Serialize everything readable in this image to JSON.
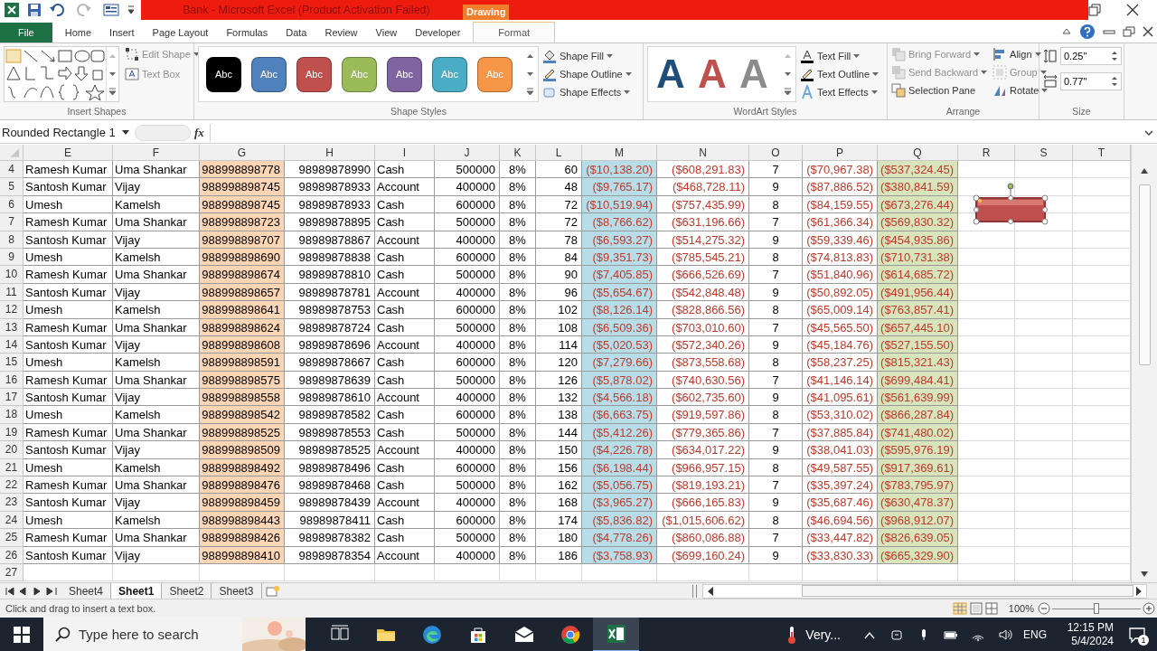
{
  "title_bar": {
    "title": "Bank - Microsoft Excel (Product Activation Failed)",
    "context_label": "Drawing"
  },
  "tabs": [
    {
      "label": "File",
      "kind": "file",
      "selected": false
    },
    {
      "label": "Home",
      "kind": "tab",
      "selected": false
    },
    {
      "label": "Insert",
      "kind": "tab",
      "selected": false
    },
    {
      "label": "Page Layout",
      "kind": "tab",
      "selected": false
    },
    {
      "label": "Formulas",
      "kind": "tab",
      "selected": false
    },
    {
      "label": "Data",
      "kind": "tab",
      "selected": false
    },
    {
      "label": "Review",
      "kind": "tab",
      "selected": false
    },
    {
      "label": "View",
      "kind": "tab",
      "selected": false
    },
    {
      "label": "Developer",
      "kind": "tab",
      "selected": false
    },
    {
      "label": "Format",
      "kind": "contextual",
      "selected": true
    }
  ],
  "ribbon": {
    "insert_shapes": {
      "label": "Insert Shapes",
      "edit_shape": "Edit Shape",
      "text_box": "Text Box"
    },
    "shape_styles": {
      "label": "Shape Styles",
      "swatches": [
        {
          "text": "Abc",
          "color": "#000000"
        },
        {
          "text": "Abc",
          "color": "#4f81bd"
        },
        {
          "text": "Abc",
          "color": "#c0504d"
        },
        {
          "text": "Abc",
          "color": "#9bbb59"
        },
        {
          "text": "Abc",
          "color": "#8064a2"
        },
        {
          "text": "Abc",
          "color": "#4bacc6"
        },
        {
          "text": "Abc",
          "color": "#f79646"
        }
      ],
      "commands": [
        "Shape Fill",
        "Shape Outline",
        "Shape Effects"
      ]
    },
    "wordart_styles": {
      "label": "WordArt Styles",
      "letters": [
        {
          "text": "A",
          "color": "#1f4e79"
        },
        {
          "text": "A",
          "color": "#c0504d"
        },
        {
          "text": "A",
          "color": "#8c8c8c"
        }
      ],
      "commands": [
        "Text Fill",
        "Text Outline",
        "Text Effects"
      ]
    },
    "arrange": {
      "label": "Arrange",
      "commands": [
        {
          "label": "Bring Forward",
          "disabled": true
        },
        {
          "label": "Send Backward",
          "disabled": true
        },
        {
          "label": "Selection Pane",
          "disabled": false
        },
        {
          "label": "Align",
          "disabled": false
        },
        {
          "label": "Group",
          "disabled": true
        },
        {
          "label": "Rotate",
          "disabled": false
        }
      ]
    },
    "size": {
      "label": "Size",
      "height": "0.25\"",
      "width": "0.77\""
    }
  },
  "formula_bar": {
    "name_box": "Rounded Rectangle 1",
    "fx": "fx"
  },
  "sheet": {
    "columns": [
      {
        "label": "E",
        "kind": "text"
      },
      {
        "label": "F",
        "kind": "text"
      },
      {
        "label": "G",
        "kind": "number",
        "color": "#fcd5b4"
      },
      {
        "label": "H",
        "kind": "number"
      },
      {
        "label": "I",
        "kind": "text"
      },
      {
        "label": "J",
        "kind": "number"
      },
      {
        "label": "K",
        "kind": "center"
      },
      {
        "label": "L",
        "kind": "number"
      },
      {
        "label": "M",
        "kind": "negative",
        "color": "#b7dee8"
      },
      {
        "label": "N",
        "kind": "negative"
      },
      {
        "label": "O",
        "kind": "center"
      },
      {
        "label": "P",
        "kind": "negative"
      },
      {
        "label": "Q",
        "kind": "negative",
        "color": "#d8e4bc"
      },
      {
        "label": "R",
        "kind": "text"
      },
      {
        "label": "S",
        "kind": "text"
      },
      {
        "label": "T",
        "kind": "text"
      }
    ],
    "rows": [
      {
        "header": "4",
        "cells": [
          "Ramesh Kumar",
          "Uma Shankar",
          "988998898778",
          "98989878990",
          "Cash",
          "500000",
          "8%",
          "60",
          "($10,138.20)",
          "($608,291.83)",
          "7",
          "($70,967.38)",
          "($537,324.45)"
        ]
      },
      {
        "header": "5",
        "cells": [
          "Santosh Kumar",
          "Vijay",
          "988998898745",
          "98989878933",
          "Account",
          "400000",
          "8%",
          "48",
          "($9,765.17)",
          "($468,728.11)",
          "9",
          "($87,886.52)",
          "($380,841.59)"
        ]
      },
      {
        "header": "6",
        "cells": [
          "Umesh",
          "Kamelsh",
          "988998898745",
          "98989878933",
          "Cash",
          "600000",
          "8%",
          "72",
          "($10,519.94)",
          "($757,435.99)",
          "8",
          "($84,159.55)",
          "($673,276.44)"
        ]
      },
      {
        "header": "7",
        "cells": [
          "Ramesh Kumar",
          "Uma Shankar",
          "988998898723",
          "98989878895",
          "Cash",
          "500000",
          "8%",
          "72",
          "($8,766.62)",
          "($631,196.66)",
          "7",
          "($61,366.34)",
          "($569,830.32)"
        ]
      },
      {
        "header": "8",
        "cells": [
          "Santosh Kumar",
          "Vijay",
          "988998898707",
          "98989878867",
          "Account",
          "400000",
          "8%",
          "78",
          "($6,593.27)",
          "($514,275.32)",
          "9",
          "($59,339.46)",
          "($454,935.86)"
        ]
      },
      {
        "header": "9",
        "cells": [
          "Umesh",
          "Kamelsh",
          "988998898690",
          "98989878838",
          "Cash",
          "600000",
          "8%",
          "84",
          "($9,351.73)",
          "($785,545.21)",
          "8",
          "($74,813.83)",
          "($710,731.38)"
        ]
      },
      {
        "header": "10",
        "cells": [
          "Ramesh Kumar",
          "Uma Shankar",
          "988998898674",
          "98989878810",
          "Cash",
          "500000",
          "8%",
          "90",
          "($7,405.85)",
          "($666,526.69)",
          "7",
          "($51,840.96)",
          "($614,685.72)"
        ]
      },
      {
        "header": "11",
        "cells": [
          "Santosh Kumar",
          "Vijay",
          "988998898657",
          "98989878781",
          "Account",
          "400000",
          "8%",
          "96",
          "($5,654.67)",
          "($542,848.48)",
          "9",
          "($50,892.05)",
          "($491,956.44)"
        ]
      },
      {
        "header": "12",
        "cells": [
          "Umesh",
          "Kamelsh",
          "988998898641",
          "98989878753",
          "Cash",
          "600000",
          "8%",
          "102",
          "($8,126.14)",
          "($828,866.56)",
          "8",
          "($65,009.14)",
          "($763,857.41)"
        ]
      },
      {
        "header": "13",
        "cells": [
          "Ramesh Kumar",
          "Uma Shankar",
          "988998898624",
          "98989878724",
          "Cash",
          "500000",
          "8%",
          "108",
          "($6,509.36)",
          "($703,010.60)",
          "7",
          "($45,565.50)",
          "($657,445.10)"
        ]
      },
      {
        "header": "14",
        "cells": [
          "Santosh Kumar",
          "Vijay",
          "988998898608",
          "98989878696",
          "Account",
          "400000",
          "8%",
          "114",
          "($5,020.53)",
          "($572,340.26)",
          "9",
          "($45,184.76)",
          "($527,155.50)"
        ]
      },
      {
        "header": "15",
        "cells": [
          "Umesh",
          "Kamelsh",
          "988998898591",
          "98989878667",
          "Cash",
          "600000",
          "8%",
          "120",
          "($7,279.66)",
          "($873,558.68)",
          "8",
          "($58,237.25)",
          "($815,321.43)"
        ]
      },
      {
        "header": "16",
        "cells": [
          "Ramesh Kumar",
          "Uma Shankar",
          "988998898575",
          "98989878639",
          "Cash",
          "500000",
          "8%",
          "126",
          "($5,878.02)",
          "($740,630.56)",
          "7",
          "($41,146.14)",
          "($699,484.41)"
        ]
      },
      {
        "header": "17",
        "cells": [
          "Santosh Kumar",
          "Vijay",
          "988998898558",
          "98989878610",
          "Account",
          "400000",
          "8%",
          "132",
          "($4,566.18)",
          "($602,735.60)",
          "9",
          "($41,095.61)",
          "($561,639.99)"
        ]
      },
      {
        "header": "18",
        "cells": [
          "Umesh",
          "Kamelsh",
          "988998898542",
          "98989878582",
          "Cash",
          "600000",
          "8%",
          "138",
          "($6,663.75)",
          "($919,597.86)",
          "8",
          "($53,310.02)",
          "($866,287.84)"
        ]
      },
      {
        "header": "19",
        "cells": [
          "Ramesh Kumar",
          "Uma Shankar",
          "988998898525",
          "98989878553",
          "Cash",
          "500000",
          "8%",
          "144",
          "($5,412.26)",
          "($779,365.86)",
          "7",
          "($37,885.84)",
          "($741,480.02)"
        ]
      },
      {
        "header": "20",
        "cells": [
          "Santosh Kumar",
          "Vijay",
          "988998898509",
          "98989878525",
          "Account",
          "400000",
          "8%",
          "150",
          "($4,226.78)",
          "($634,017.22)",
          "9",
          "($38,041.03)",
          "($595,976.19)"
        ]
      },
      {
        "header": "21",
        "cells": [
          "Umesh",
          "Kamelsh",
          "988998898492",
          "98989878496",
          "Cash",
          "600000",
          "8%",
          "156",
          "($6,198.44)",
          "($966,957.15)",
          "8",
          "($49,587.55)",
          "($917,369.61)"
        ]
      },
      {
        "header": "22",
        "cells": [
          "Ramesh Kumar",
          "Uma Shankar",
          "988998898476",
          "98989878468",
          "Cash",
          "500000",
          "8%",
          "162",
          "($5,056.75)",
          "($819,193.21)",
          "7",
          "($35,397.24)",
          "($783,795.97)"
        ]
      },
      {
        "header": "23",
        "cells": [
          "Santosh Kumar",
          "Vijay",
          "988998898459",
          "98989878439",
          "Account",
          "400000",
          "8%",
          "168",
          "($3,965.27)",
          "($666,165.83)",
          "9",
          "($35,687.46)",
          "($630,478.37)"
        ]
      },
      {
        "header": "24",
        "cells": [
          "Umesh",
          "Kamelsh",
          "988998898443",
          "98989878411",
          "Cash",
          "600000",
          "8%",
          "174",
          "($5,836.82)",
          "($1,015,606.62)",
          "8",
          "($46,694.56)",
          "($968,912.07)"
        ]
      },
      {
        "header": "25",
        "cells": [
          "Ramesh Kumar",
          "Uma Shankar",
          "988998898426",
          "98989878382",
          "Cash",
          "500000",
          "8%",
          "180",
          "($4,778.26)",
          "($860,086.88)",
          "7",
          "($33,447.82)",
          "($826,639.05)"
        ]
      },
      {
        "header": "26",
        "cells": [
          "Santosh Kumar",
          "Vijay",
          "988998898410",
          "98989878354",
          "Account",
          "400000",
          "8%",
          "186",
          "($3,758.93)",
          "($699,160.24)",
          "9",
          "($33,830.33)",
          "($665,329.90)"
        ]
      },
      {
        "header": "27",
        "cells": []
      }
    ]
  },
  "sheet_tabs": [
    {
      "label": "Sheet4",
      "selected": false
    },
    {
      "label": "Sheet1",
      "selected": true
    },
    {
      "label": "Sheet2",
      "selected": false
    },
    {
      "label": "Sheet3",
      "selected": false
    }
  ],
  "status_bar": {
    "message": "Click and drag to insert a text box.",
    "zoom": "100%",
    "zoom_slider": {
      "level": 0.5
    }
  },
  "taskbar": {
    "search_placeholder": "Type here to search",
    "weather": "Very...",
    "language": "ENG",
    "time": "12:15 PM",
    "date": "5/4/2024",
    "notifications": "1"
  }
}
